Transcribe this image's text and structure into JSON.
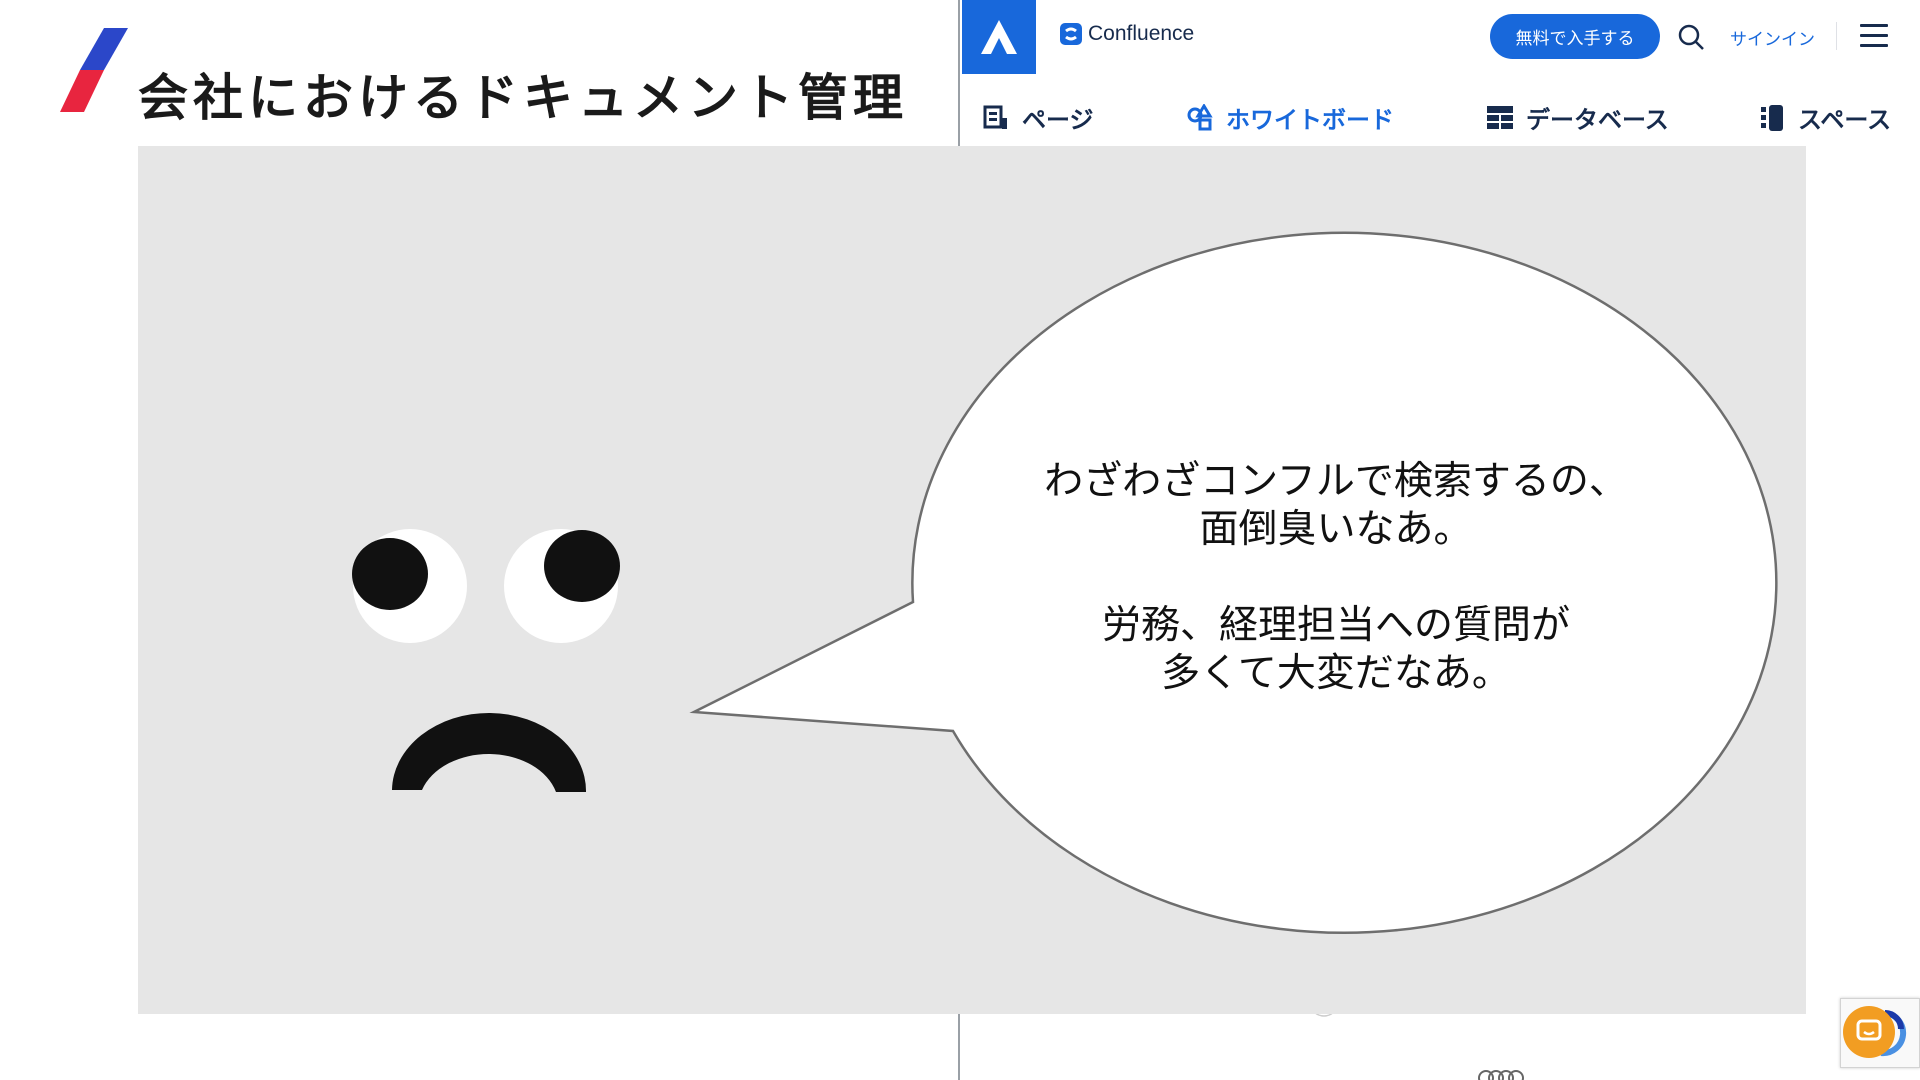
{
  "slide": {
    "title": "会社におけるドキュメント管理",
    "accent_colors": [
      "#2b47c9",
      "#e8253f"
    ]
  },
  "site": {
    "brand": "Confluence",
    "header": {
      "free_button": "無料で入手する",
      "signin": "サインイン",
      "icons": [
        "atlassian-logo",
        "confluence-logo",
        "search-icon",
        "hamburger-menu-icon"
      ]
    },
    "nav": [
      {
        "label": "ページ",
        "icon": "page-icon"
      },
      {
        "label": "ホワイトボード",
        "icon": "whiteboard-icon",
        "active": true
      },
      {
        "label": "データベース",
        "icon": "database-icon"
      },
      {
        "label": "スペース",
        "icon": "space-icon"
      }
    ],
    "accent_color": "#1868db"
  },
  "speech_bubble": {
    "line1": "わざわざコンフルで検索するの、",
    "line2": "面倒臭いなあ。",
    "line3": "労務、経理担当への質問が",
    "line4": "多くて大変だなあ。"
  },
  "widgets": {
    "chat_icon": "chat-icon",
    "chat_color": "#f29d22",
    "recaptcha_icon": "recaptcha-icon"
  }
}
